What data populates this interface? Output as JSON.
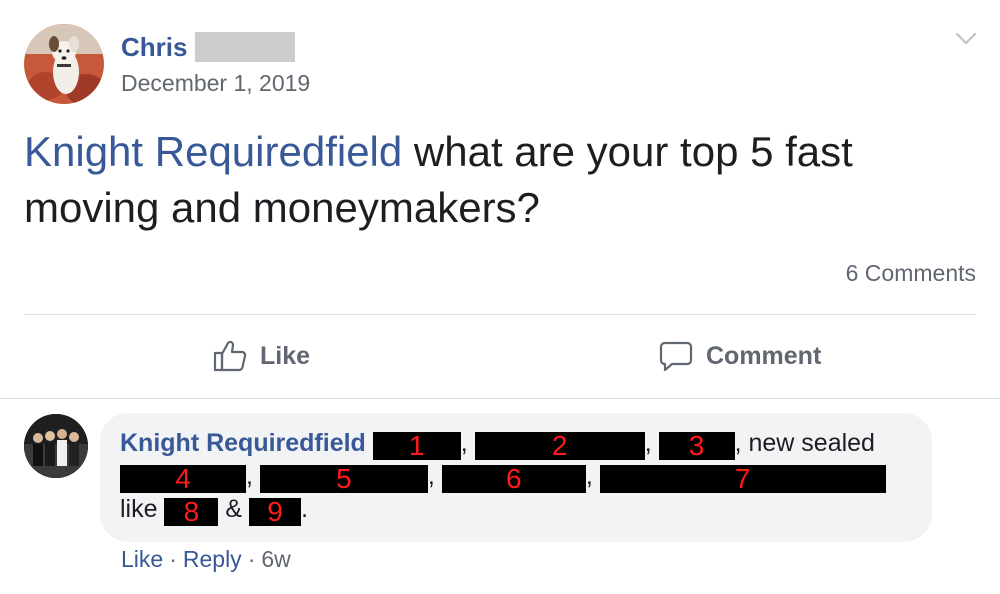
{
  "post": {
    "author_name": "Chris",
    "date": "December 1, 2019",
    "mention": "Knight Requiredfield",
    "text": " what are your top 5 fast moving and moneymakers?",
    "comment_count": "6 Comments"
  },
  "actions": {
    "like_label": "Like",
    "comment_label": "Comment"
  },
  "comment": {
    "author": "Knight Requiredfield",
    "redaction_labels": [
      "1",
      "2",
      "3",
      "4",
      "5",
      "6",
      "7",
      "8",
      "9"
    ],
    "text_new_sealed": ", new sealed",
    "text_like": "like",
    "text_amp": "&",
    "text_end": ".",
    "sep_comma": ",",
    "like_label": "Like",
    "reply_label": "Reply",
    "age": "6w",
    "dot": "·"
  },
  "colors": {
    "link_blue": "#385898",
    "secondary_gray": "#606770",
    "bubble_bg": "#f2f3f5",
    "redaction_text": "#ff1a1a"
  },
  "icons": {
    "like": "thumbs-up-icon",
    "comment": "speech-bubble-icon",
    "menu": "chevron-down-icon"
  }
}
